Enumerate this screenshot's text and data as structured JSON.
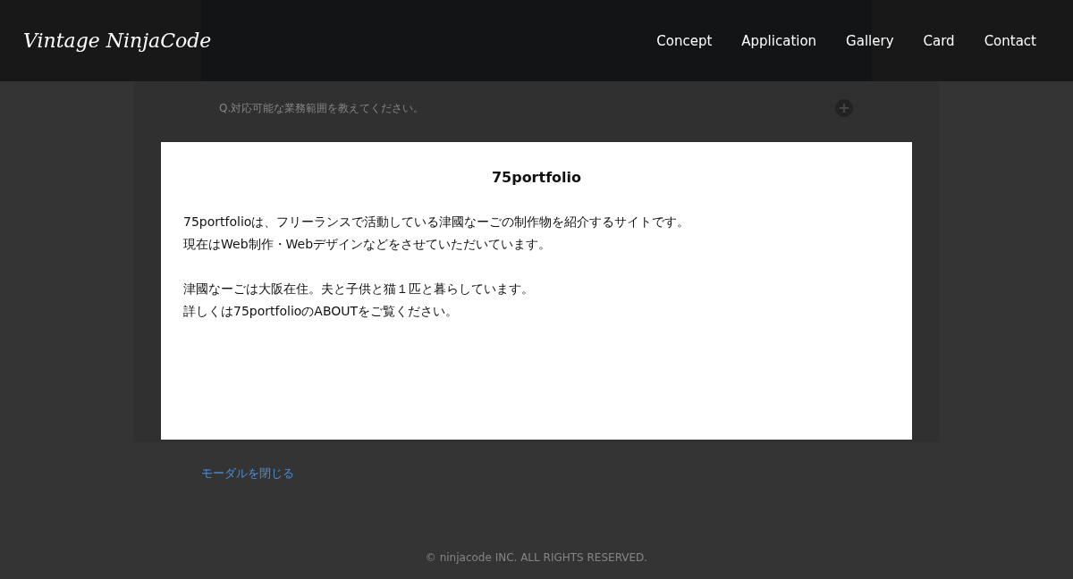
{
  "header": {
    "logo": "Vintage NinjaCode",
    "nav": [
      "Concept",
      "Application",
      "Gallery",
      "Card",
      "Contact"
    ]
  },
  "faq": {
    "question": "Q.対応可能な業務範囲を教えてください。"
  },
  "modal": {
    "title": "75portfolio",
    "paragraphs": [
      [
        "75portfolioは、フリーランスで活動している津國なーごの制作物を紹介するサイトです。",
        "現在はWeb制作・Webデザインなどをさせていただいています。"
      ],
      [
        "津國なーごは大阪在住。夫と子供と猫１匹と暮らしています。",
        "詳しくは75portfolioのABOUTをご覧ください。"
      ]
    ]
  },
  "close_link": "モーダルを閉じる",
  "footer": "© ninjacode INC. ALL RIGHTS RESERVED."
}
